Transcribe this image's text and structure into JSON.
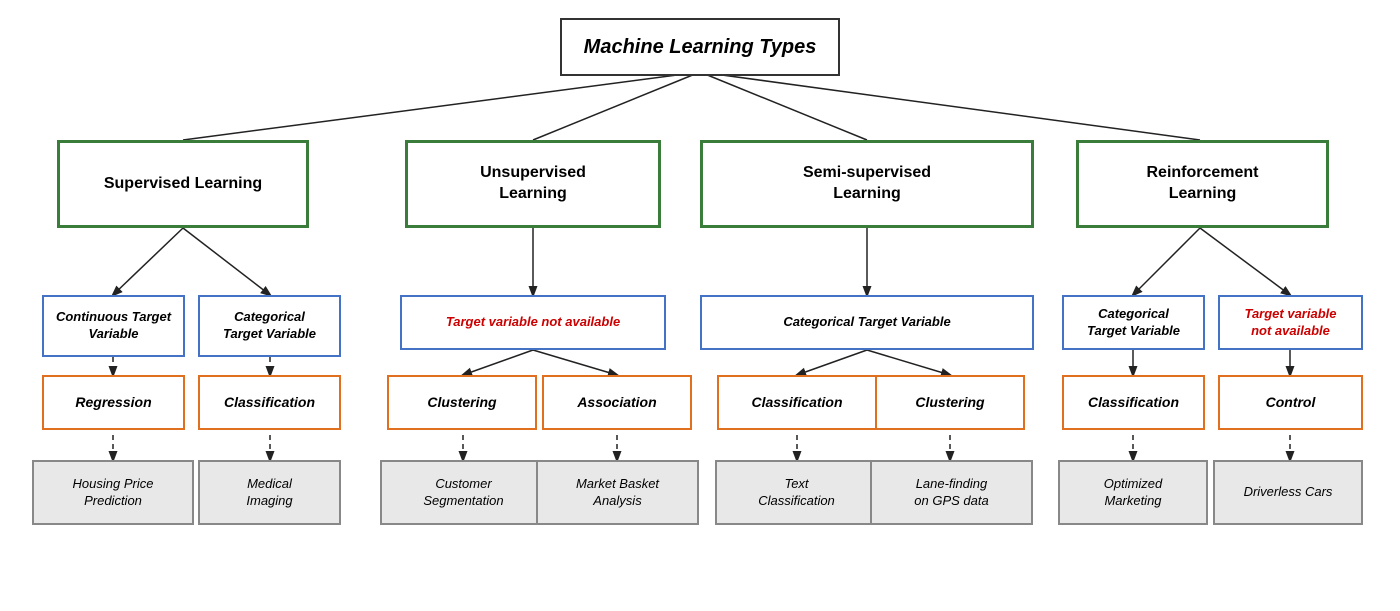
{
  "title": "Machine Learning Types",
  "nodes": {
    "root": {
      "label": "Machine Learning Types"
    },
    "supervised": {
      "label": "Supervised Learning"
    },
    "unsupervised": {
      "label": "Unsupervised\nLearning"
    },
    "semi": {
      "label": "Semi-supervised\nLearning"
    },
    "reinforcement": {
      "label": "Reinforcement\nLearning"
    },
    "continuous": {
      "label": "Continuous\nTarget Variable"
    },
    "categorical_sup": {
      "label": "Categorical\nTarget Variable"
    },
    "target_not_avail_unsup": {
      "label": "Target variable not available"
    },
    "categorical_semi": {
      "label": "Categorical Target Variable"
    },
    "categorical_reinf": {
      "label": "Categorical\nTarget Variable"
    },
    "target_not_avail_reinf": {
      "label": "Target variable\nnot available"
    },
    "regression": {
      "label": "Regression"
    },
    "classification_sup": {
      "label": "Classification"
    },
    "clustering_unsup": {
      "label": "Clustering"
    },
    "association": {
      "label": "Association"
    },
    "classification_semi": {
      "label": "Classification"
    },
    "clustering_semi": {
      "label": "Clustering"
    },
    "classification_reinf": {
      "label": "Classification"
    },
    "control": {
      "label": "Control"
    },
    "housing": {
      "label": "Housing Price\nPrediction"
    },
    "medical": {
      "label": "Medical\nImaging"
    },
    "customer": {
      "label": "Customer\nSegmentation"
    },
    "market": {
      "label": "Market Basket\nAnalysis"
    },
    "text_class": {
      "label": "Text\nClassification"
    },
    "lane": {
      "label": "Lane-finding\non GPS data"
    },
    "optimized": {
      "label": "Optimized\nMarketing"
    },
    "driverless": {
      "label": "Driverless Cars"
    }
  }
}
